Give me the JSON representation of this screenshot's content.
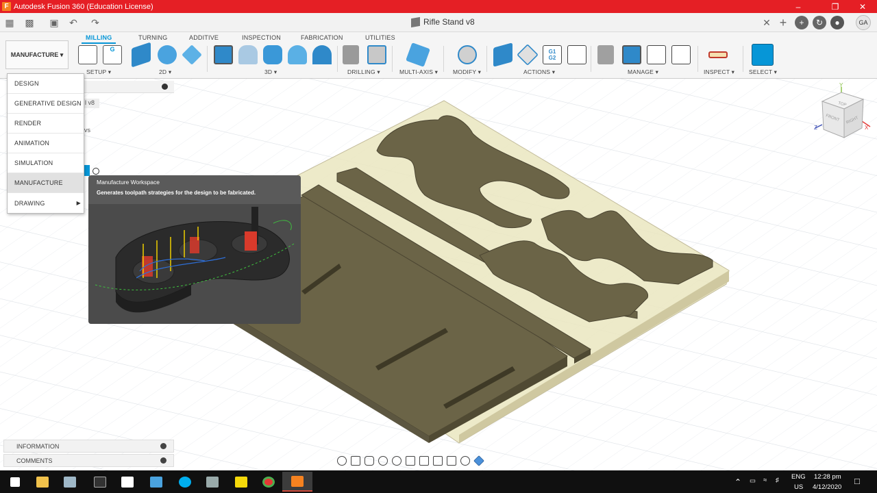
{
  "window": {
    "title": "Autodesk Fusion 360 (Education License)",
    "app_icon_letter": "F"
  },
  "document": {
    "title": "Rifle Stand v8"
  },
  "user": {
    "initials": "GA"
  },
  "ribbon": {
    "workspace_button": "MANUFACTURE ▾",
    "tabs": [
      "MILLING",
      "TURNING",
      "ADDITIVE",
      "INSPECTION",
      "FABRICATION",
      "UTILITIES"
    ],
    "active_tab": "MILLING",
    "groups": [
      "SETUP ▾",
      "2D ▾",
      "3D ▾",
      "DRILLING ▾",
      "MULTI-AXIS ▾",
      "MODIFY ▾",
      "ACTIONS ▾",
      "MANAGE ▾",
      "INSPECT ▾",
      "SELECT ▾"
    ],
    "g_code_label_1": "G1",
    "g_code_label_2": "G2",
    "setup_g": "G"
  },
  "workspace_menu": {
    "items": [
      {
        "label": "DESIGN"
      },
      {
        "label": "GENERATIVE DESIGN"
      },
      {
        "label": "RENDER"
      },
      {
        "label": "ANIMATION"
      },
      {
        "label": "SIMULATION"
      },
      {
        "label": "MANUFACTURE"
      },
      {
        "label": "DRAWING"
      }
    ],
    "hovered": "MANUFACTURE",
    "drawing_arrow": "▶"
  },
  "browser": {
    "doc_fragment": "l v8",
    "item_fragment": "vs"
  },
  "tooltip": {
    "title": "Manufacture Workspace",
    "description": "Generates toolpath strategies for the design to be fabricated."
  },
  "bottom_panels": {
    "information": "INFORMATION",
    "comments": "COMMENTS"
  },
  "viewcube": {
    "top": "TOP",
    "front": "FRONT",
    "right": "RIGHT",
    "axis_y": "Y",
    "axis_z": "Z",
    "axis_x": "X"
  },
  "taskbar": {
    "language_line1": "ENG",
    "language_line2": "US",
    "time": "12:28 pm",
    "date": "4/12/2020"
  },
  "colors": {
    "title_bar": "#e51f25",
    "accent": "#0696d7",
    "part_face": "#6b6447",
    "stock": "#e9e4b8"
  }
}
